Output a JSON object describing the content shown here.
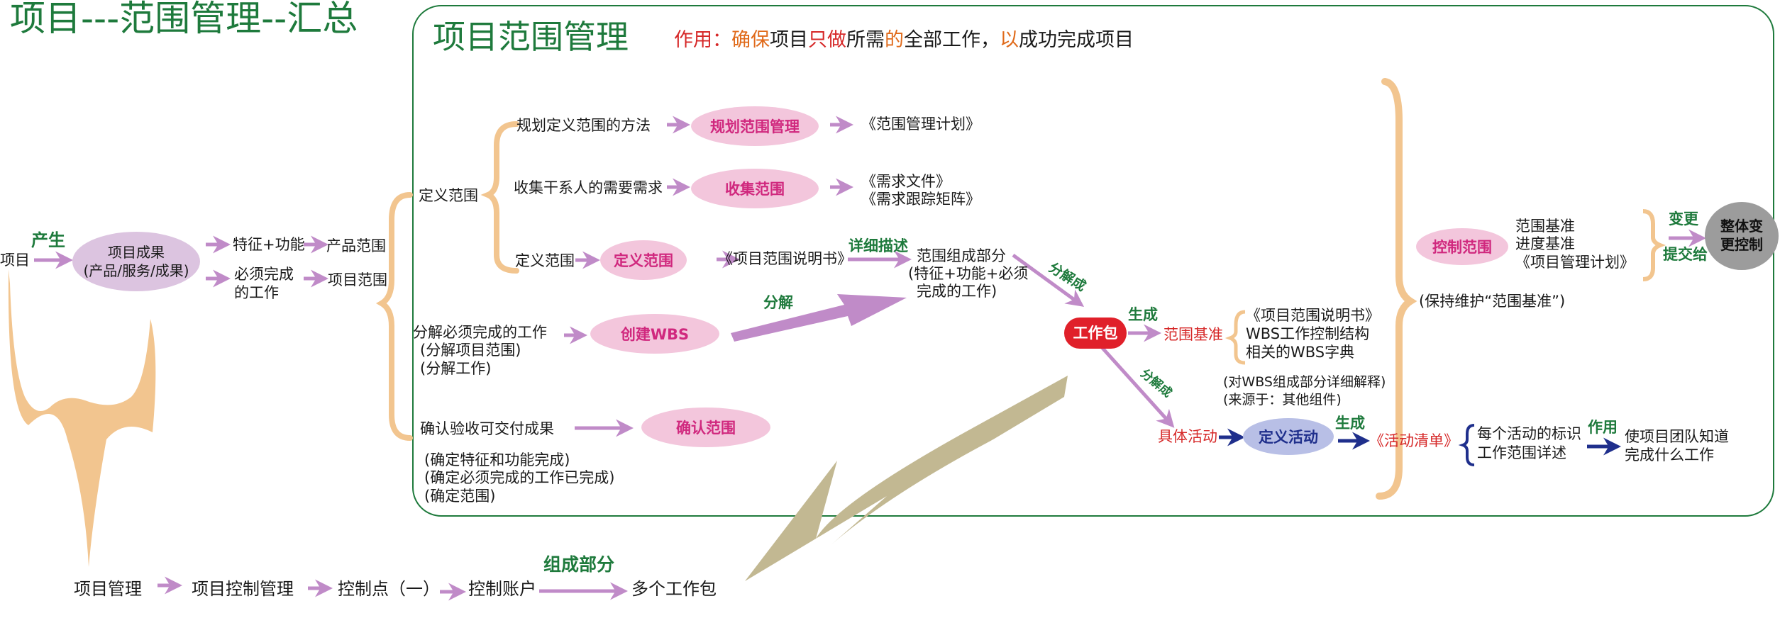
{
  "colors": {
    "green": "#1e7a3c",
    "pink_fill": "#f3c6dc",
    "pink_text": "#d0287e",
    "brace": "#f2c58f",
    "arrow": "#c08bc8",
    "navy": "#1f2f8c",
    "red": "#d62828",
    "khaki": "#c2b892"
  },
  "title": "项目---范围管理--汇总",
  "frame": {
    "title": "项目范围管理",
    "purpose_label": "作用：",
    "purpose_1": "确保",
    "purpose_2": "项目",
    "purpose_3": "只做",
    "purpose_4": "所需",
    "purpose_5": "的",
    "purpose_6": "全部工作，",
    "purpose_7": "以",
    "purpose_8": "成功完成项目"
  },
  "left": {
    "project": "项目",
    "produce": "产生",
    "result_line1": "项目成果",
    "result_line2": "(产品/服务/成果)",
    "feature": "特征+功能",
    "product_scope": "产品范围",
    "must_work_1": "必须完成",
    "must_work_2": "的工作",
    "project_scope": "项目范围"
  },
  "processes": {
    "define_scope": "定义范围",
    "plan_method": "规划定义范围的方法",
    "plan_scope": "规划范围管理",
    "plan_output": "《范围管理计划》",
    "collect_need": "收集干系人的需要需求",
    "collect": "收集范围",
    "collect_out1": "《需求文件》",
    "collect_out2": "《需求跟踪矩阵》",
    "define_small": "定义范围",
    "define": "定义范围",
    "define_out": "《项目范围说明书》",
    "detail": "详细描述",
    "components_1": "范围组成部分",
    "components_2": "(特征+功能+必须",
    "components_3": "完成的工作)",
    "decompose_work": "分解必须完成的工作",
    "decompose_p1": "(分解项目范围)",
    "decompose_p2": "(分解工作)",
    "wbs": "创建WBS",
    "decompose": "分解",
    "decompose_into1": "分解成",
    "decompose_into2": "分解成",
    "verify_work": "确认验收可交付成果",
    "verify": "确认范围",
    "verify_n1": "(确定特征和功能完成)",
    "verify_n2": "(确定必须完成的工作已完成)",
    "verify_n3": "(确定范围)"
  },
  "middle": {
    "work_package": "工作包",
    "generate1": "生成",
    "scope_baseline": "范围基准",
    "baseline_i1": "《项目范围说明书》",
    "baseline_i2": "WBS工作控制结构",
    "baseline_i3": "相关的WBS字典",
    "note1": "(对WBS组成部分详细解释)",
    "note2": "(来源于：其他组件)",
    "activities": "具体活动",
    "define_activities": "定义活动",
    "generate2": "生成",
    "activity_list": "《活动清单》",
    "act_i1": "每个活动的标识",
    "act_i2": "工作范围详述",
    "effect": "作用",
    "team_1": "使项目团队知道",
    "team_2": "完成什么工作"
  },
  "right": {
    "control": "控制范围",
    "b1": "范围基准",
    "b2": "进度基准",
    "b3": "《项目管理计划》",
    "change": "变更",
    "submit": "提交给",
    "integrated_1": "整体变",
    "integrated_2": "更控制",
    "maintain": "(保持维护“范围基准”)"
  },
  "bottom": {
    "pm": "项目管理",
    "pcm": "项目控制管理",
    "cp": "控制点（一）",
    "ca": "控制账户",
    "component": "组成部分",
    "wp": "多个工作包"
  }
}
